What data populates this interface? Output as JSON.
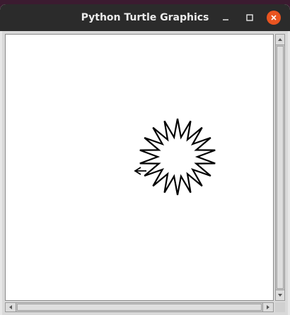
{
  "window": {
    "title": "Python Turtle Graphics",
    "controls": {
      "minimize": "minimize-icon",
      "maximize": "maximize-icon",
      "close": "close-icon"
    },
    "colors": {
      "titlebar": "#2b2b2b",
      "close_button": "#e95420",
      "canvas": "#ffffff",
      "pen": "#000000"
    }
  },
  "drawing": {
    "shape": "star",
    "star_points": 18,
    "pen_color": "#000000",
    "turtle_cursor": "arrow"
  }
}
